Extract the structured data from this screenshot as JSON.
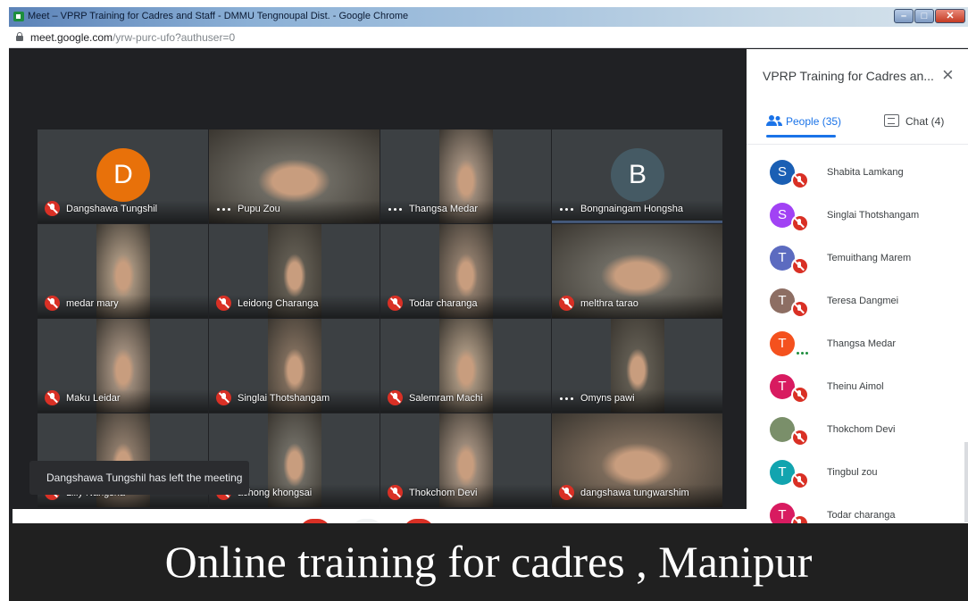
{
  "browser": {
    "window_title": "Meet – VPRP Training for Cadres and Staff - DMMU Tengnoupal Dist. - Google Chrome",
    "url_main": "meet.google.com",
    "url_path": "/yrw-purc-ufo?authuser=0"
  },
  "meeting": {
    "tiles": [
      {
        "name": "Dangshawa Tungshil",
        "state": "muted",
        "avatar_letter": "D",
        "avatar_color": "#e8710a"
      },
      {
        "name": "Pupu Zou",
        "state": "speaking"
      },
      {
        "name": "Thangsa Medar",
        "state": "speaking"
      },
      {
        "name": "Bongnaingam Hongsha",
        "state": "speaking",
        "avatar_letter": "B",
        "avatar_color": "#455a64"
      },
      {
        "name": "medar mary",
        "state": "muted"
      },
      {
        "name": "Leidong Charanga",
        "state": "muted"
      },
      {
        "name": "Todar charanga",
        "state": "muted"
      },
      {
        "name": "melthra tarao",
        "state": "muted"
      },
      {
        "name": "Maku Leidar",
        "state": "muted"
      },
      {
        "name": "Singlai Thotshangam",
        "state": "muted"
      },
      {
        "name": "Salemram Machi",
        "state": "muted"
      },
      {
        "name": "Omyns pawi",
        "state": "speaking"
      },
      {
        "name": "Lilly Nangsha",
        "state": "muted"
      },
      {
        "name": "achong khongsai",
        "state": "muted"
      },
      {
        "name": "Thokchom Devi",
        "state": "muted"
      },
      {
        "name": "dangshawa tungwarshim",
        "state": "muted"
      }
    ],
    "toast": "Dangshawa Tungshil has left the meeting"
  },
  "panel": {
    "title": "VPRP Training for Cadres an...",
    "close_icon": "×",
    "tab_people": "People (35)",
    "tab_chat": "Chat (4)",
    "participants": [
      {
        "name": "Shabita Lamkang",
        "letter": "S",
        "color": "#1a5fb4",
        "muted": true
      },
      {
        "name": "Singlai Thotshangam",
        "letter": "S",
        "color": "#a142f4",
        "muted": true
      },
      {
        "name": "Temuithang Marem",
        "letter": "T",
        "color": "#5c6bc0",
        "muted": true
      },
      {
        "name": "Teresa Dangmei",
        "letter": "T",
        "color": "#8d6e63",
        "muted": true
      },
      {
        "name": "Thangsa Medar",
        "letter": "T",
        "color": "#f4511e",
        "muted": false
      },
      {
        "name": "Theinu Aimol",
        "letter": "T",
        "color": "#d81b60",
        "muted": true
      },
      {
        "name": "Thokchom Devi",
        "letter": "",
        "color": "#7a8f6a",
        "muted": true
      },
      {
        "name": "Tingbul zou",
        "letter": "T",
        "color": "#12a4af",
        "muted": true
      },
      {
        "name": "Todar charanga",
        "letter": "T",
        "color": "#d81b60",
        "muted": true
      }
    ]
  },
  "caption": "Online training for cadres , Manipur"
}
